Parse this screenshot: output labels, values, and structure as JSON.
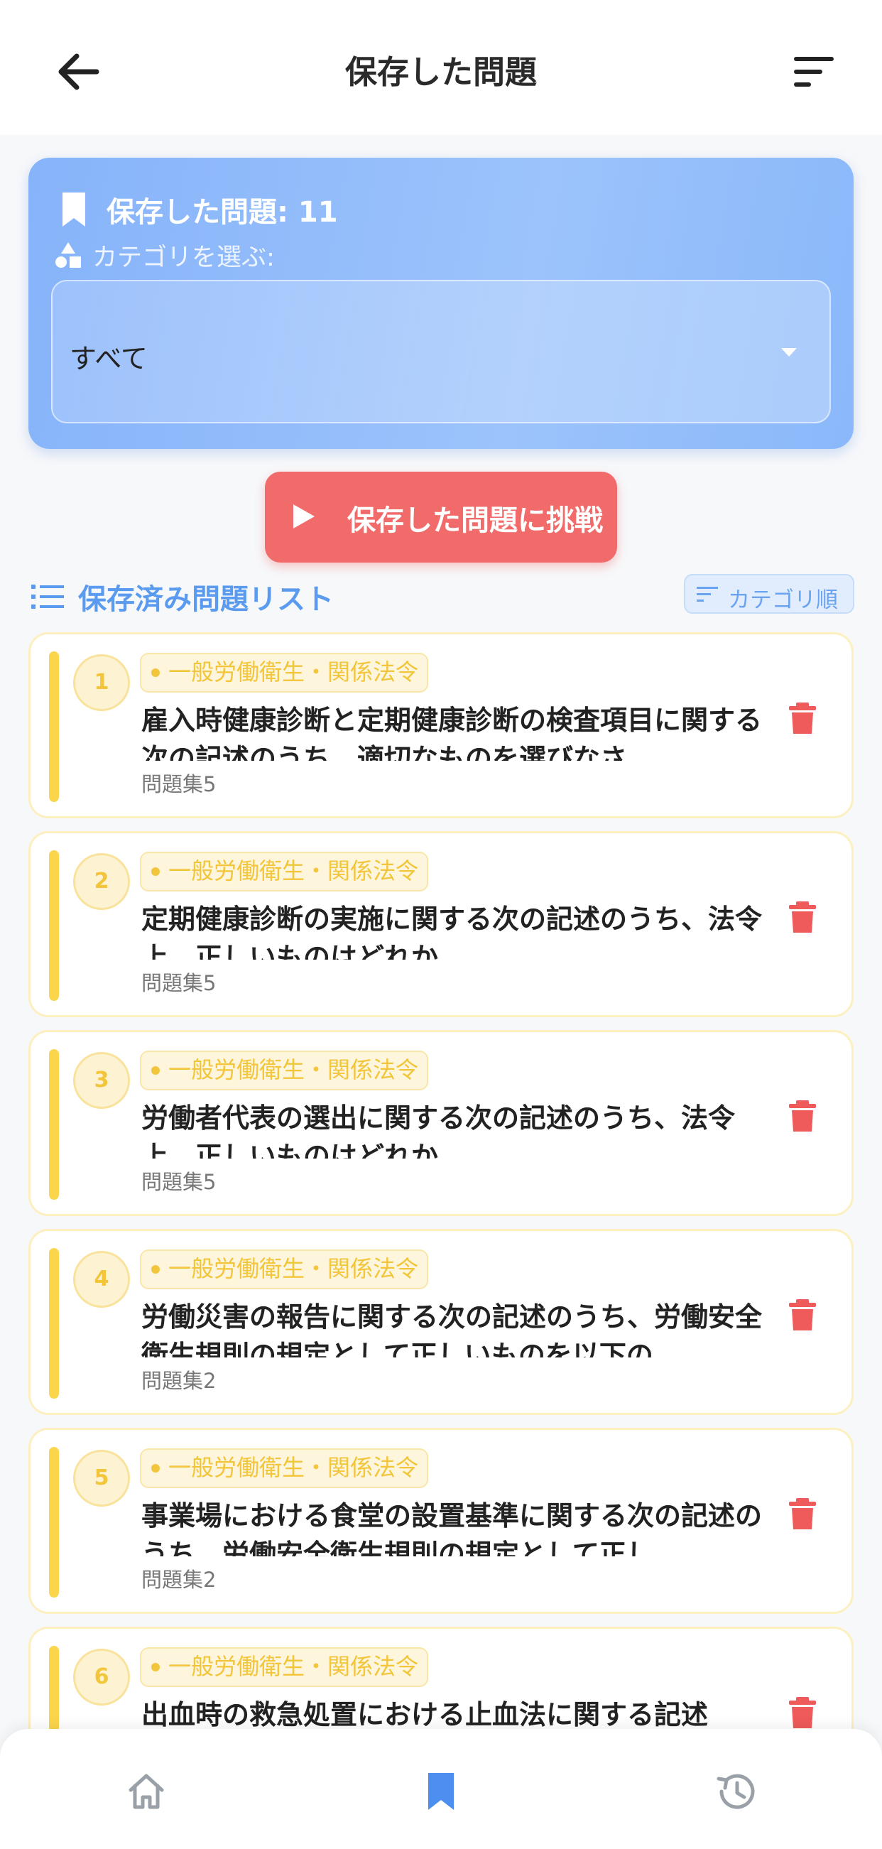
{
  "appbar": {
    "title": "保存した問題",
    "back_icon": "arrow-left-icon",
    "sort_icon": "sort-lines-icon"
  },
  "summary": {
    "saved_count_label": "保存した問題: 11",
    "category_label": "カテゴリを選ぶ:",
    "category_value": "すべて"
  },
  "actions": {
    "challenge_label": "保存した問題に挑戦"
  },
  "list": {
    "heading": "保存済み問題リスト",
    "sort_label": "カテゴリ順",
    "items": [
      {
        "number": "1",
        "category": "一般労働衛生・関係法令",
        "question": "雇入時健康診断と定期健康診断の検査項目に関する次の記述のうち、適切なものを選びなさ",
        "set": "問題集5"
      },
      {
        "number": "2",
        "category": "一般労働衛生・関係法令",
        "question": "定期健康診断の実施に関する次の記述のうち、法令上、正しいものはどれか",
        "set": "問題集5"
      },
      {
        "number": "3",
        "category": "一般労働衛生・関係法令",
        "question": "労働者代表の選出に関する次の記述のうち、法令上、正しいものはどれか",
        "set": "問題集5"
      },
      {
        "number": "4",
        "category": "一般労働衛生・関係法令",
        "question": "労働災害の報告に関する次の記述のうち、労働安全衛生規則の規定として正しいものを以下の",
        "set": "問題集2"
      },
      {
        "number": "5",
        "category": "一般労働衛生・関係法令",
        "question": "事業場における食堂の設置基準に関する次の記述のうち、労働安全衛生規則の規定として正し",
        "set": "問題集2"
      },
      {
        "number": "6",
        "category": "一般労働衛生・関係法令",
        "question": "出血時の救急処置における止血法に関する記述",
        "set": ""
      }
    ]
  },
  "nav": {
    "items": [
      "home-icon",
      "bookmark-icon",
      "history-icon"
    ]
  },
  "colors": {
    "accent_blue": "#5b9bef",
    "danger": "#f26b6b",
    "tag_yellow": "#f3c53a"
  }
}
